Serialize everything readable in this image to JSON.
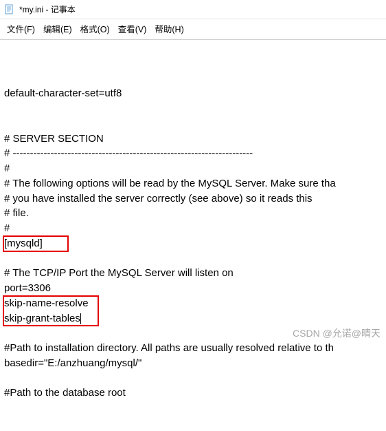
{
  "window": {
    "title": "*my.ini - 记事本",
    "icon": "notepad-icon"
  },
  "menu": {
    "file": "文件(F)",
    "edit": "编辑(E)",
    "format": "格式(O)",
    "view": "查看(V)",
    "help": "帮助(H)"
  },
  "content": {
    "lines": [
      "default-character-set=utf8",
      "",
      "",
      "# SERVER SECTION",
      "# ----------------------------------------------------------------------",
      "#",
      "# The following options will be read by the MySQL Server. Make sure tha",
      "# you have installed the server correctly (see above) so it reads this",
      "# file.",
      "#",
      "[mysqld]",
      "",
      "# The TCP/IP Port the MySQL Server will listen on",
      "port=3306",
      "skip-name-resolve",
      "skip-grant-tables",
      "",
      "#Path to installation directory. All paths are usually resolved relative to th",
      "basedir=\"E:/anzhuang/mysql/\"",
      "",
      "#Path to the database root"
    ]
  },
  "watermark": "CSDN @允诺@晴天"
}
